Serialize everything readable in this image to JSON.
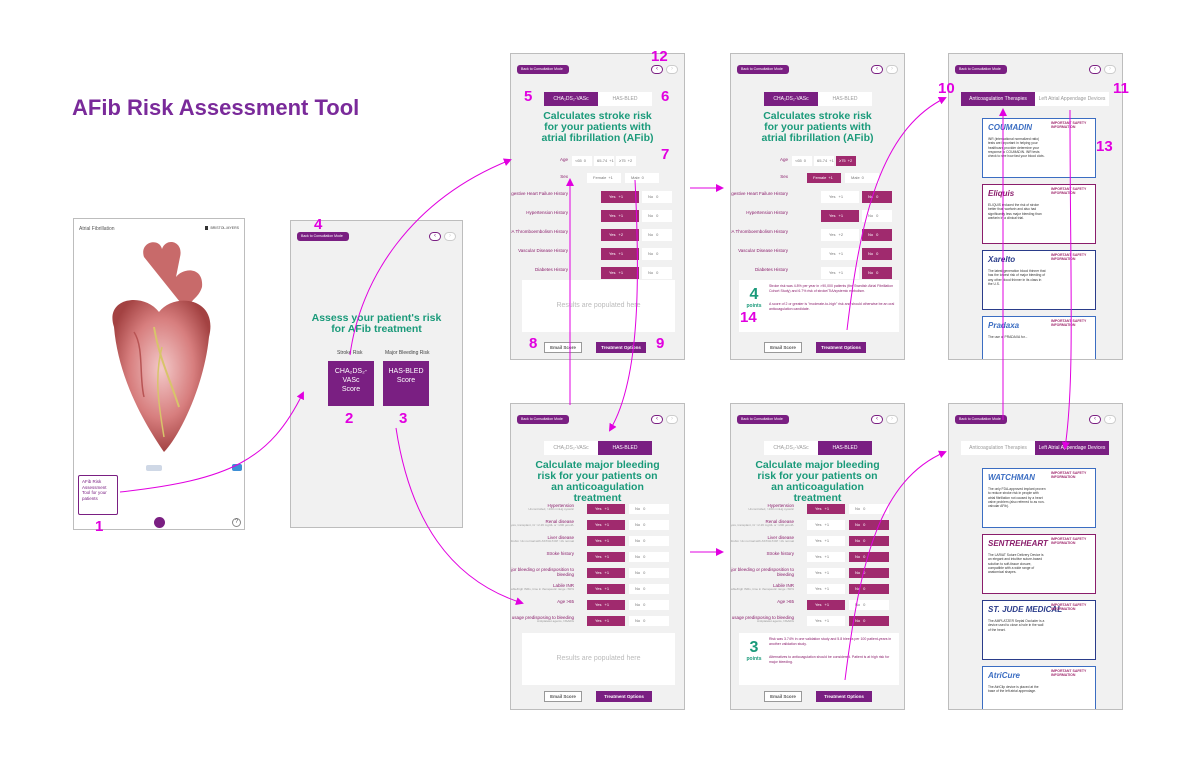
{
  "page_title": "AFib Risk Assessment Tool",
  "back_label": "Back to Consultation Mode",
  "nav_prev": "‹",
  "nav_next": "›",
  "screen1": {
    "title": "Atrial Fibrillation",
    "brand": "BRISTOL-MYERS",
    "card_text": "AFib Risk Assessment Tool for your patients",
    "help": "?"
  },
  "screen2": {
    "title": "Assess your patient's risk for AFib treatment",
    "stroke_label": "Stroke Risk",
    "bleeding_label": "Major Bleeding Risk",
    "chads_btn": "CHA₂DS₂-VASc Score",
    "hasbled_btn": "HAS-BLED Score"
  },
  "chads": {
    "tab_left": "CHA₂DS₂-VASc",
    "tab_right": "HAS-BLED",
    "heading": "Calculates stroke risk for your patients with atrial fibrillation (AFib)",
    "age_label": "Age",
    "age_opts": [
      "<65",
      "65-74",
      "≥75"
    ],
    "age_pts": [
      "0",
      "+1",
      "+2"
    ],
    "sex_label": "Sex",
    "sex_opts": [
      "Female",
      "Male"
    ],
    "sex_pts": [
      "+1",
      "0"
    ],
    "rows": [
      "Congestive Heart Failure History",
      "Hypertension History",
      "Stroke/TIA Thromboembolism History",
      "Vascular Disease History",
      "Diabetes History"
    ],
    "yes": "Yes",
    "no": "No",
    "y_pts": [
      "+1",
      "+1",
      "+2",
      "+1",
      "+1"
    ],
    "n_pts": "0",
    "results_placeholder": "Results are populated here",
    "email_btn": "Email Score",
    "treat_btn": "Treatment Options",
    "score_num": "4",
    "score_word": "points",
    "score_text": "Stroke risk was 4.8% per year in >90,000 patients (the Swedish Atrial Fibrillation Cohort Study) and 6.7% risk of stroke/TIA/systemic embolism.",
    "score_text2": "A score of 2 or greater is \"moderate-to-high\" risk and should otherwise be an oral anticoagulation candidate."
  },
  "hasbled": {
    "heading": "Calculate major bleeding risk for your patients on an anticoagulation treatment",
    "rows": [
      {
        "label": "Hypertension",
        "sub": "Uncontrolled, >160 mmHg systolic"
      },
      {
        "label": "Renal disease",
        "sub": "Dialysis, transplant, Cr >2.26 mg/dL or >200 µmol/L"
      },
      {
        "label": "Liver disease",
        "sub": "Cirrhosis or bilirubin >2x normal with AST/ALT/AP >3x normal"
      },
      {
        "label": "Stroke history",
        "sub": ""
      },
      {
        "label": "Prior major bleeding or predisposition to bleeding",
        "sub": ""
      },
      {
        "label": "Labile INR",
        "sub": "Unstable/high INRs, time in therapeutic range <60%"
      },
      {
        "label": "Age >65",
        "sub": ""
      },
      {
        "label": "Medication usage predisposing to bleeding",
        "sub": "Antiplatelet agents, NSAIDs"
      }
    ],
    "score_num": "3",
    "score_word": "points",
    "score_text": "Risk was 3.74% in one validation study and 5.8 bleeds per 100 patient-years in another validation study.",
    "score_text2": "Alternatives to anticoagulation should be considered. Patient is at high risk for major bleeding."
  },
  "therapies": {
    "tab_left": "Anticoagulation Therapies",
    "tab_right": "Left Atrial Appendage Devices",
    "safety": "IMPORTANT SAFETY INFORMATION",
    "cards": [
      {
        "logo": "COUMADIN",
        "text": "INR (international normalized ratio) tests are important in helping your healthcare provider determine your response to COUMADIN. INR tests check to see how fast your blood clots."
      },
      {
        "logo": "Eliquis",
        "text": "ELIQUIS reduced the risk of stroke better than warfarin and also had significantly less major bleeding than warfarin in a clinical trial."
      },
      {
        "logo": "Xarelto",
        "text": "The latest-generation blood thinner that has the lowest risk of major bleeding of any other blood thinner in its class in the U.S."
      },
      {
        "logo": "Pradaxa",
        "text": "The use of PRADAXA for..."
      }
    ]
  },
  "devices": {
    "cards": [
      {
        "logo": "WATCHMAN",
        "text": "The only FDA-approved implant proven to reduce stroke risk in people with atrial fibrillation not caused by a heart valve problem (also referred to as non-valvular AFib)."
      },
      {
        "logo": "SENTREHEART",
        "text": "The LARIAT Suture Delivery Device is an elegant and intuitive suture-based solution to soft-tissue closure, compatible with a wide range of anatomical shapes."
      },
      {
        "logo": "ST. JUDE MEDICAL",
        "text": "The AMPLATZER Septal Occluder is a device used to close a hole in the wall of the heart."
      },
      {
        "logo": "AtriCure",
        "text": "The AtriClip device is placed at the base of the left atrial appendage."
      }
    ]
  },
  "annotations": [
    "1",
    "2",
    "3",
    "4",
    "5",
    "6",
    "7",
    "8",
    "9",
    "10",
    "11",
    "12",
    "13",
    "14"
  ],
  "colors": {
    "brand": "#7a1f82",
    "accent": "#1a9a7a",
    "annotation": "#e100e0",
    "selected": "#a02a6e"
  }
}
